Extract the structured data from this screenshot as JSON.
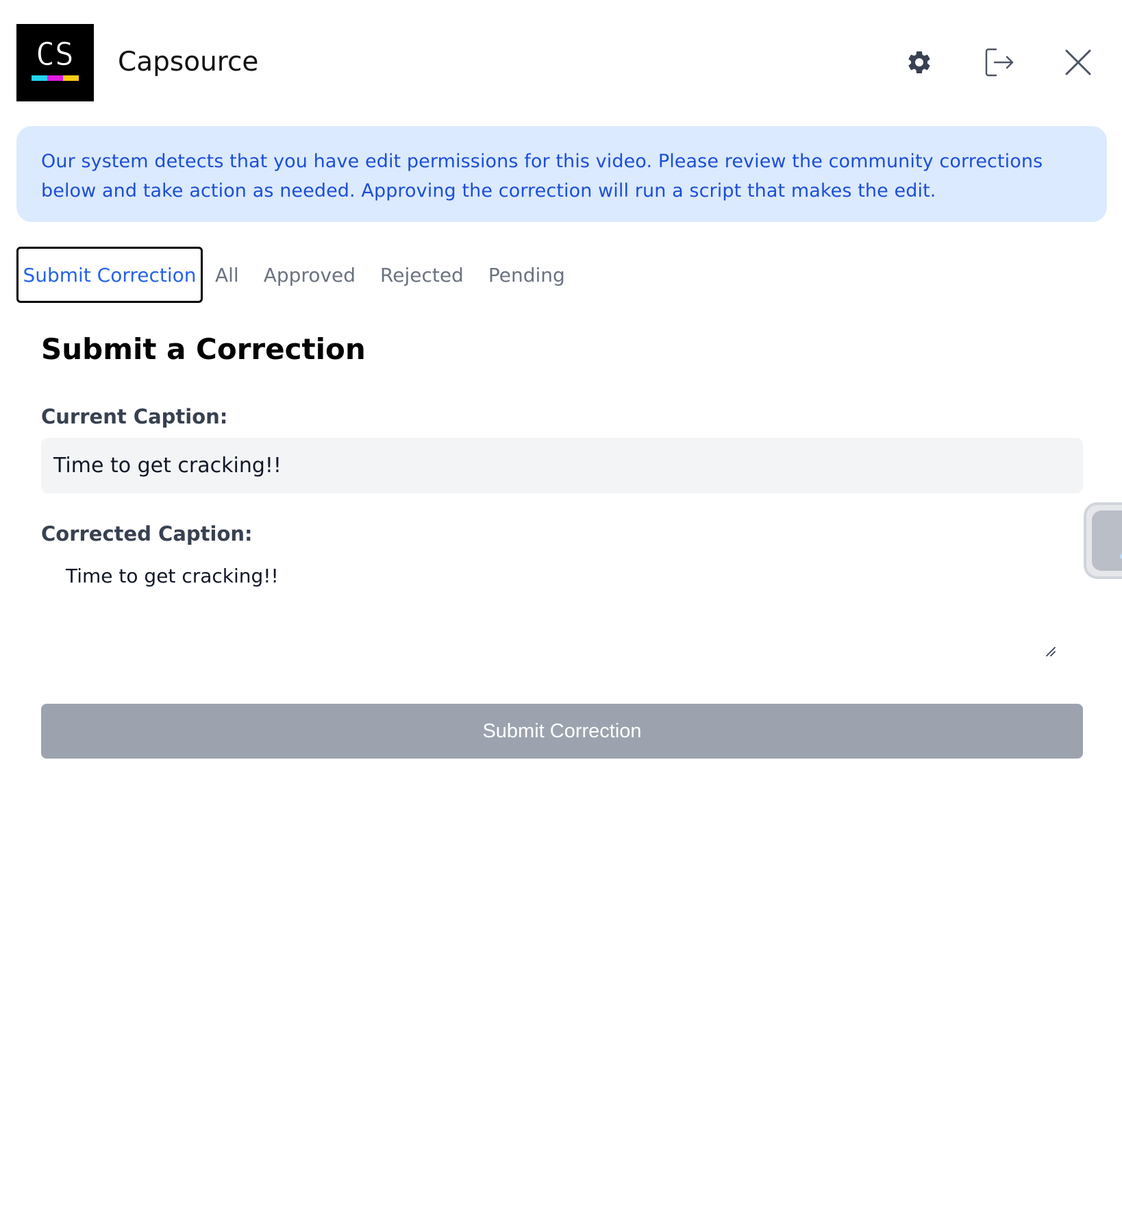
{
  "header": {
    "app_name": "Capsource",
    "logo_text": "CS",
    "icons": [
      "gear-icon",
      "logout-icon",
      "close-icon"
    ]
  },
  "banner": {
    "text": "Our system detects that you have edit permissions for this video. Please review the community corrections below and take action as needed. Approving the correction will run a script that makes the edit."
  },
  "tabs": [
    {
      "label": "Submit Correction",
      "active": true
    },
    {
      "label": "All",
      "active": false
    },
    {
      "label": "Approved",
      "active": false
    },
    {
      "label": "Rejected",
      "active": false
    },
    {
      "label": "Pending",
      "active": false
    }
  ],
  "form": {
    "title": "Submit a Correction",
    "current_label": "Current Caption:",
    "current_value": "Time to get cracking!!",
    "corrected_label": "Corrected Caption:",
    "corrected_value": "Time to get cracking!!",
    "submit_label": "Submit Correction"
  },
  "colors": {
    "accent": "#2563eb",
    "banner_bg": "#dbeafe",
    "banner_text": "#1d4ed8",
    "disabled_button": "#9ca3af"
  }
}
